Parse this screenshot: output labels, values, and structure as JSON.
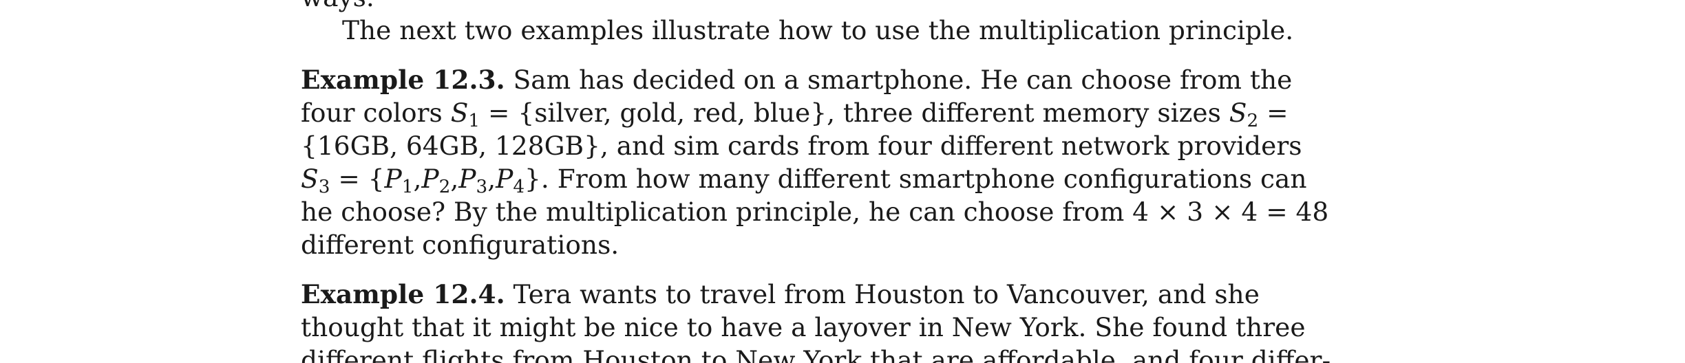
{
  "document": {
    "cutoff_top_word": "ways.",
    "intro_sentence": "The next two examples illustrate how to use the multiplication principle.",
    "example_1": {
      "label": "Example 12.3.",
      "line_1_text": "Sam has decided on a smartphone. He can choose from the",
      "line_2_start": "four colors",
      "line_2_set_1": "{silver, gold, red, blue},",
      "line_2_middle": "three different memory sizes",
      "line_3_set_2": "{16GB, 64GB, 128GB},",
      "line_3_rest": "and sim cards from four different network providers",
      "line_4_set_3_open": "{",
      "line_4_set_3_close": "}.",
      "line_4_rest": "From how many different smartphone configurations can",
      "line_5_text": "he choose? By the multiplication principle, he can choose from 4 × 3 × 4 = 48",
      "line_6_text": "different configurations."
    },
    "example_2": {
      "label": "Example 12.4.",
      "line_1_text": "Tera wants to travel from Houston to Vancouver, and she",
      "line_2_text": "thought that it might be nice to have a layover in New York. She found three",
      "line_3_text": "different flights from Houston to New York that are affordable, and four differ-"
    },
    "symbols": {
      "S": "S",
      "P": "P",
      "equals": "=",
      "comma": ",",
      "sub_1": "1",
      "sub_2": "2",
      "sub_3": "3",
      "sub_4": "4"
    }
  }
}
